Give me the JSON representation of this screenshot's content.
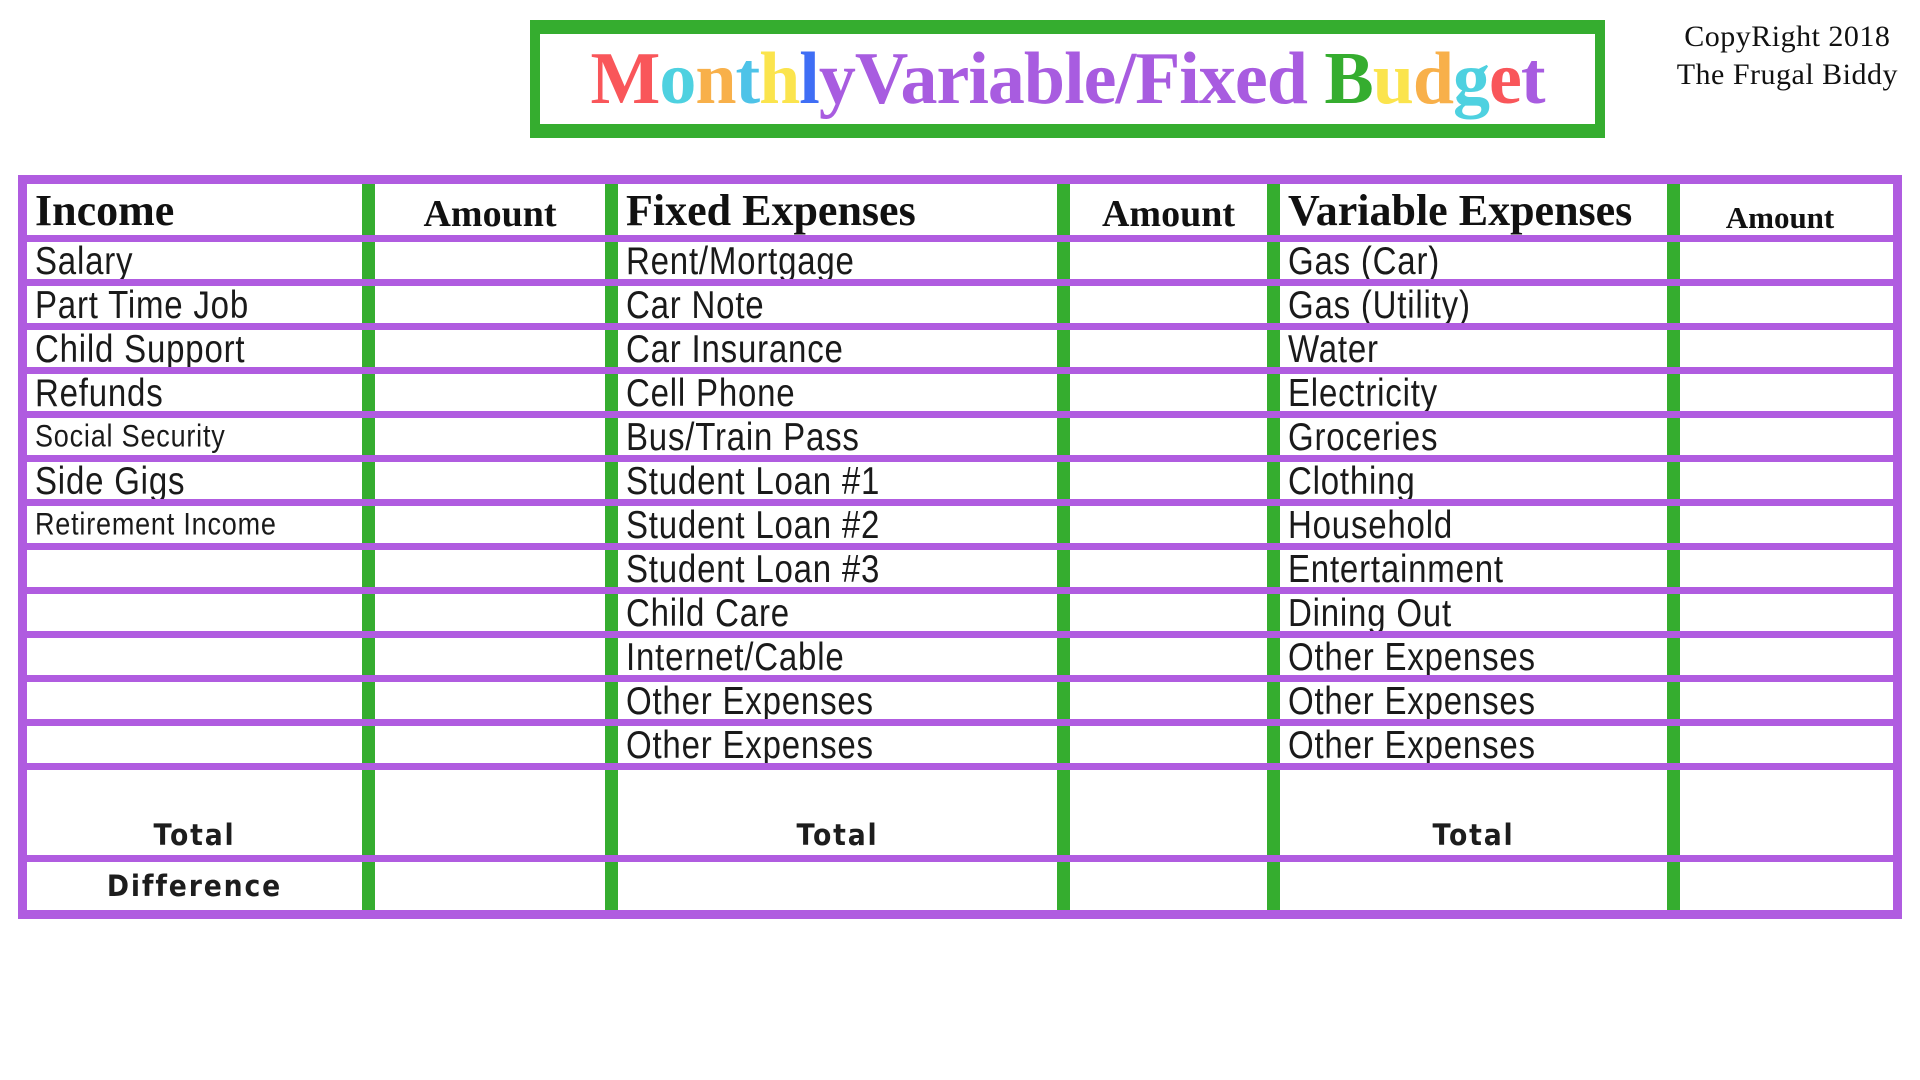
{
  "title": {
    "frame_color": "#35ad2f",
    "letters": [
      {
        "ch": "M",
        "color": "#f9565a"
      },
      {
        "ch": "o",
        "color": "#4ed1e0"
      },
      {
        "ch": "n",
        "color": "#f8b04a"
      },
      {
        "ch": "t",
        "color": "#4ec3e8"
      },
      {
        "ch": "h",
        "color": "#fbe44d"
      },
      {
        "ch": "l",
        "color": "#3f6ef5"
      },
      {
        "ch": "y",
        "color": "#a85ce0"
      },
      {
        "ch": "V",
        "color": "#a85ce0"
      },
      {
        "ch": "a",
        "color": "#a85ce0"
      },
      {
        "ch": "r",
        "color": "#a85ce0"
      },
      {
        "ch": "i",
        "color": "#a85ce0"
      },
      {
        "ch": "a",
        "color": "#a85ce0"
      },
      {
        "ch": "b",
        "color": "#a85ce0"
      },
      {
        "ch": "l",
        "color": "#a85ce0"
      },
      {
        "ch": "e",
        "color": "#a85ce0"
      },
      {
        "ch": "/",
        "color": "#a85ce0"
      },
      {
        "ch": "F",
        "color": "#a85ce0"
      },
      {
        "ch": "i",
        "color": "#a85ce0"
      },
      {
        "ch": "x",
        "color": "#a85ce0"
      },
      {
        "ch": "e",
        "color": "#a85ce0"
      },
      {
        "ch": "d",
        "color": "#a85ce0"
      },
      {
        "ch": " ",
        "color": "#a85ce0"
      },
      {
        "ch": "B",
        "color": "#35ad2f"
      },
      {
        "ch": "u",
        "color": "#fbe44d"
      },
      {
        "ch": "d",
        "color": "#f8b04a"
      },
      {
        "ch": "g",
        "color": "#4ed1e0"
      },
      {
        "ch": "e",
        "color": "#f9565a"
      },
      {
        "ch": "t",
        "color": "#a85ce0"
      }
    ],
    "plain_text": "MonthlyVariable/Fixed Budget"
  },
  "copyright": {
    "line1": "CopyRight 2018",
    "line2": "The Frugal Biddy"
  },
  "table": {
    "colors": {
      "row_divider": "#b05ce0",
      "column_divider": "#35ad2f",
      "text": "#1a1a1a",
      "background": "#ffffff"
    },
    "headers": {
      "income": "Income",
      "amount1": "Amount",
      "fixed": "Fixed Expenses",
      "amount2": "Amount",
      "variable": "Variable Expenses",
      "amount3": "Amount"
    },
    "income_rows": [
      {
        "label": "Salary",
        "amount": "",
        "small": false
      },
      {
        "label": "Part Time Job",
        "amount": "",
        "small": false
      },
      {
        "label": "Child Support",
        "amount": "",
        "small": false
      },
      {
        "label": "Refunds",
        "amount": "",
        "small": false
      },
      {
        "label": "Social Security",
        "amount": "",
        "small": true
      },
      {
        "label": "Side Gigs",
        "amount": "",
        "small": false
      },
      {
        "label": "Retirement Income",
        "amount": "",
        "small": true
      },
      {
        "label": "",
        "amount": "",
        "small": false
      },
      {
        "label": "",
        "amount": "",
        "small": false
      },
      {
        "label": "",
        "amount": "",
        "small": false
      },
      {
        "label": "",
        "amount": "",
        "small": false
      },
      {
        "label": "",
        "amount": "",
        "small": false
      },
      {
        "label": "",
        "amount": "",
        "small": false
      }
    ],
    "fixed_rows": [
      {
        "label": "Rent/Mortgage",
        "amount": ""
      },
      {
        "label": "Car Note",
        "amount": ""
      },
      {
        "label": "Car Insurance",
        "amount": ""
      },
      {
        "label": "Cell Phone",
        "amount": ""
      },
      {
        "label": "Bus/Train Pass",
        "amount": ""
      },
      {
        "label": "Student Loan #1",
        "amount": ""
      },
      {
        "label": "Student Loan #2",
        "amount": ""
      },
      {
        "label": "Student Loan #3",
        "amount": ""
      },
      {
        "label": "Child Care",
        "amount": ""
      },
      {
        "label": "Internet/Cable",
        "amount": ""
      },
      {
        "label": "Other Expenses",
        "amount": ""
      },
      {
        "label": "Other Expenses",
        "amount": ""
      },
      {
        "label": "",
        "amount": ""
      }
    ],
    "variable_rows": [
      {
        "label": "Gas (Car)",
        "amount": ""
      },
      {
        "label": "Gas (Utility)",
        "amount": ""
      },
      {
        "label": "Water",
        "amount": ""
      },
      {
        "label": "Electricity",
        "amount": ""
      },
      {
        "label": "Groceries",
        "amount": ""
      },
      {
        "label": "Clothing",
        "amount": ""
      },
      {
        "label": "Household",
        "amount": ""
      },
      {
        "label": "Entertainment",
        "amount": ""
      },
      {
        "label": "Dining Out",
        "amount": ""
      },
      {
        "label": "Other Expenses",
        "amount": ""
      },
      {
        "label": "Other Expenses",
        "amount": ""
      },
      {
        "label": "Other Expenses",
        "amount": ""
      },
      {
        "label": "",
        "amount": ""
      }
    ],
    "total_row": {
      "income_label": "Total",
      "income_amount": "",
      "fixed_label": "Total",
      "fixed_amount": "",
      "variable_label": "Total",
      "variable_amount": ""
    },
    "difference_row": {
      "income_label": "Difference",
      "income_amount": "",
      "fixed_label": "",
      "fixed_amount": "",
      "variable_label": "",
      "variable_amount": ""
    }
  }
}
